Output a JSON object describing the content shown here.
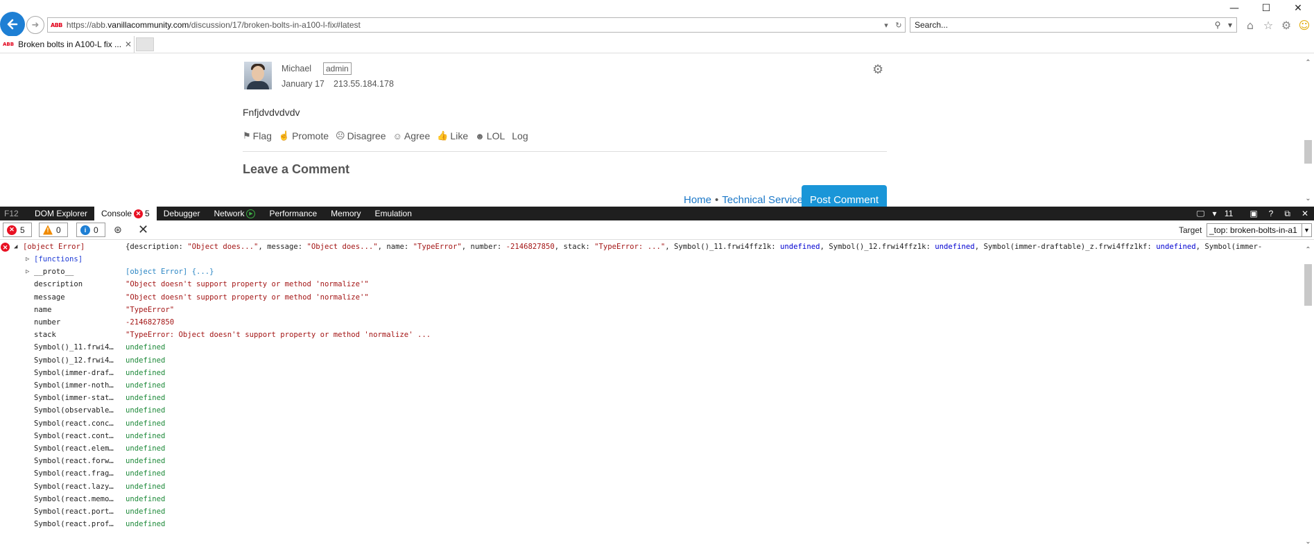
{
  "window": {
    "minimize": "—",
    "maximize": "☐",
    "close": "✕"
  },
  "address": {
    "url_prefix": "https://abb.",
    "url_domain": "vanillacommunity.com",
    "url_path": "/discussion/17/broken-bolts-in-a100-l-fix#latest",
    "favicon_text": "ABB"
  },
  "search": {
    "placeholder": "Search..."
  },
  "tab": {
    "title": "Broken bolts in A100-L fix ...",
    "favicon_text": "ABB"
  },
  "comment": {
    "author": "Michael",
    "role": "admin",
    "date": "January 17",
    "ip": "213.55.184.178",
    "body": "Fnfjdvdvdvdv",
    "reactions": [
      "Flag",
      "Promote",
      "Disagree",
      "Agree",
      "Like",
      "LOL",
      "Log"
    ],
    "reaction_icons": [
      "⚑",
      "☝",
      "☹",
      "☺",
      "👍",
      "☻",
      ""
    ],
    "leave_heading": "Leave a Comment",
    "crumb_home": "Home",
    "crumb_sep": "•",
    "crumb_section": "Technical Service",
    "post_button": "Post Comment"
  },
  "devtools": {
    "f12": "F12",
    "tabs": [
      "DOM Explorer",
      "Console",
      "Debugger",
      "Network",
      "Performance",
      "Memory",
      "Emulation"
    ],
    "console_error_badge": "5",
    "right_controls": [
      "11",
      "?",
      "✕"
    ],
    "filters": {
      "errors": "5",
      "warnings": "0",
      "info": "0"
    },
    "target_label": "Target",
    "target_value": "_top: broken-bolts-in-a1"
  },
  "console": {
    "object_name": "[object Error]",
    "object_summary_parts": [
      {
        "t": "{description: ",
        "c": "k"
      },
      {
        "t": "\"Object does...\"",
        "c": "s"
      },
      {
        "t": ", message: ",
        "c": "k"
      },
      {
        "t": "\"Object does...\"",
        "c": "s"
      },
      {
        "t": ", name: ",
        "c": "k"
      },
      {
        "t": "\"TypeError\"",
        "c": "s"
      },
      {
        "t": ", number: ",
        "c": "k"
      },
      {
        "t": "-2146827850",
        "c": "s"
      },
      {
        "t": ", stack: ",
        "c": "k"
      },
      {
        "t": "\"TypeError: ...\"",
        "c": "s"
      },
      {
        "t": ", Symbol()_11.frwi4ffz1k: ",
        "c": "k"
      },
      {
        "t": "undefined",
        "c": "u"
      },
      {
        "t": ", Symbol()_12.frwi4ffz1k: ",
        "c": "k"
      },
      {
        "t": "undefined",
        "c": "u"
      },
      {
        "t": ", Symbol(immer-draftable)_z.frwi4ffz1kf: ",
        "c": "k"
      },
      {
        "t": "undefined",
        "c": "u"
      },
      {
        "t": ", Symbol(immer-",
        "c": "k"
      }
    ],
    "properties": [
      {
        "key": "[functions]",
        "val": "",
        "type": "fn",
        "expandable": true
      },
      {
        "key": "__proto__",
        "val": "[object Error] {...}",
        "type": "proto",
        "expandable": true
      },
      {
        "key": "description",
        "val": "\"Object doesn't support property or method 'normalize'\"",
        "type": "str"
      },
      {
        "key": "message",
        "val": "\"Object doesn't support property or method 'normalize'\"",
        "type": "str"
      },
      {
        "key": "name",
        "val": "\"TypeError\"",
        "type": "str"
      },
      {
        "key": "number",
        "val": "-2146827850",
        "type": "num"
      },
      {
        "key": "stack",
        "val": "\"TypeError: Object doesn't support property or method 'normalize' ...",
        "type": "str"
      },
      {
        "key": "Symbol()_11.frwi4…",
        "val": "undefined",
        "type": "undef"
      },
      {
        "key": "Symbol()_12.frwi4…",
        "val": "undefined",
        "type": "undef"
      },
      {
        "key": "Symbol(immer-draf…",
        "val": "undefined",
        "type": "undef"
      },
      {
        "key": "Symbol(immer-noth…",
        "val": "undefined",
        "type": "undef"
      },
      {
        "key": "Symbol(immer-stat…",
        "val": "undefined",
        "type": "undef"
      },
      {
        "key": "Symbol(observable…",
        "val": "undefined",
        "type": "undef"
      },
      {
        "key": "Symbol(react.conc…",
        "val": "undefined",
        "type": "undef"
      },
      {
        "key": "Symbol(react.cont…",
        "val": "undefined",
        "type": "undef"
      },
      {
        "key": "Symbol(react.elem…",
        "val": "undefined",
        "type": "undef"
      },
      {
        "key": "Symbol(react.forw…",
        "val": "undefined",
        "type": "undef"
      },
      {
        "key": "Symbol(react.frag…",
        "val": "undefined",
        "type": "undef"
      },
      {
        "key": "Symbol(react.lazy…",
        "val": "undefined",
        "type": "undef"
      },
      {
        "key": "Symbol(react.memo…",
        "val": "undefined",
        "type": "undef"
      },
      {
        "key": "Symbol(react.port…",
        "val": "undefined",
        "type": "undef"
      },
      {
        "key": "Symbol(react.prof…",
        "val": "undefined",
        "type": "undef"
      }
    ]
  },
  "colors": {
    "accent": "#1e7fd4",
    "error": "#e81123",
    "post_button": "#1a96d8",
    "string": "#a31515",
    "undefined": "#1e8a3a"
  }
}
